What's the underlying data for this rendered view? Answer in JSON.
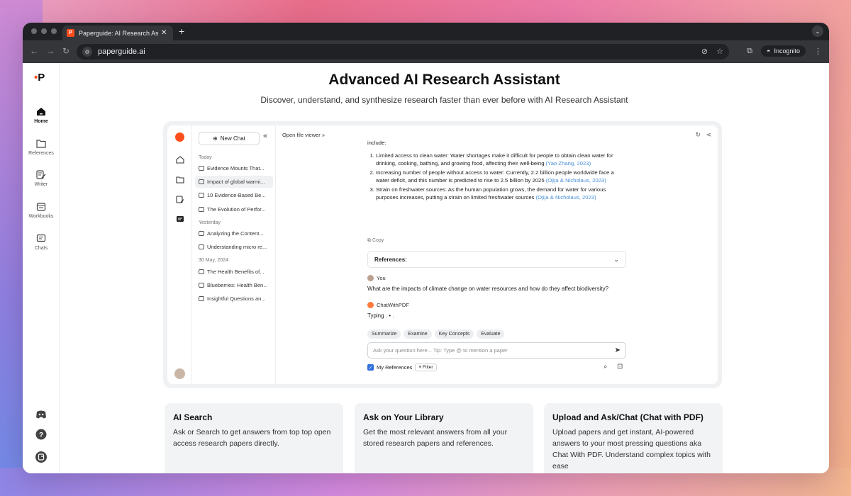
{
  "browser": {
    "tab_title": "Paperguide: AI Research Assistant",
    "favicon_text": "P",
    "new_tab": "+",
    "url": "paperguide.ai",
    "incognito_label": "Incognito"
  },
  "sidebar": {
    "logo": "P",
    "items": [
      {
        "label": "Home",
        "icon": "home-icon"
      },
      {
        "label": "References",
        "icon": "folder-icon"
      },
      {
        "label": "Writer",
        "icon": "edit-icon"
      },
      {
        "label": "Workbooks",
        "icon": "calendar-icon"
      },
      {
        "label": "Chats",
        "icon": "chat-icon"
      }
    ]
  },
  "hero": {
    "title": "Advanced AI Research Assistant",
    "subtitle": "Discover, understand, and synthesize research faster than ever before with AI Research Assistant"
  },
  "demo": {
    "new_chat": "New Chat",
    "collapse": "«",
    "groups": [
      {
        "label": "Today",
        "items": [
          "Evidence Mounts That...",
          "Impact of global warmi...",
          "10 Evidence-Based Be...",
          "The Evolution of Perfor..."
        ]
      },
      {
        "label": "Yesterday",
        "items": [
          "Analyzing the Content...",
          "Understanding micro re..."
        ]
      },
      {
        "label": "30 May, 2024",
        "items": [
          "The Health Benefits of...",
          "Blueberries: Health Ben...",
          "Insightful Questions an..."
        ]
      }
    ],
    "open_file_viewer": "Open file viewer »",
    "intro": "include:",
    "points": [
      {
        "text": "Limited access to clean water: Water shortages make it difficult for people to obtain clean water for drinking, cooking, bathing, and growing food, affecting their well-being",
        "cite": "(Yao Zhang, 2023)"
      },
      {
        "text": "Increasing number of people without access to water: Currently, 2.2 billion people worldwide face a water deficit, and this number is predicted to rise to 2.5 billion by 2025",
        "cite": "(Ojija & Nicholaus, 2023)"
      },
      {
        "text": "Strain on freshwater sources: As the human population grows, the demand for water for various purposes increases, putting a strain on limited freshwater sources",
        "cite": "(Ojija & Nicholaus, 2023)"
      }
    ],
    "copy": "Copy",
    "references": "References:",
    "you": "You",
    "question": "What are the impacts of climate change on water resources and how do they affect biodiversity?",
    "assistant": "ChatWithPDF",
    "typing": "Typing . • .",
    "chips": [
      "Summarize",
      "Examine",
      "Key Concepts",
      "Evaluate"
    ],
    "ask_placeholder": "Ask your question here... Tip: Type @ to mention a paper",
    "my_references": "My References",
    "filter": "Filter"
  },
  "cards": [
    {
      "title": "AI Search",
      "body": "Ask or Search to get answers from top top open access research papers directly."
    },
    {
      "title": "Ask on Your Library",
      "body": "Get the most relevant answers from all your stored research papers and references."
    },
    {
      "title": "Upload and Ask/Chat (Chat with PDF)",
      "body": "Upload papers and get instant, AI-powered answers to your most pressing questions aka Chat With PDF. Understand complex topics with ease"
    }
  ],
  "colors": {
    "brand": "#ff4d1c",
    "link": "#4a90d9"
  }
}
